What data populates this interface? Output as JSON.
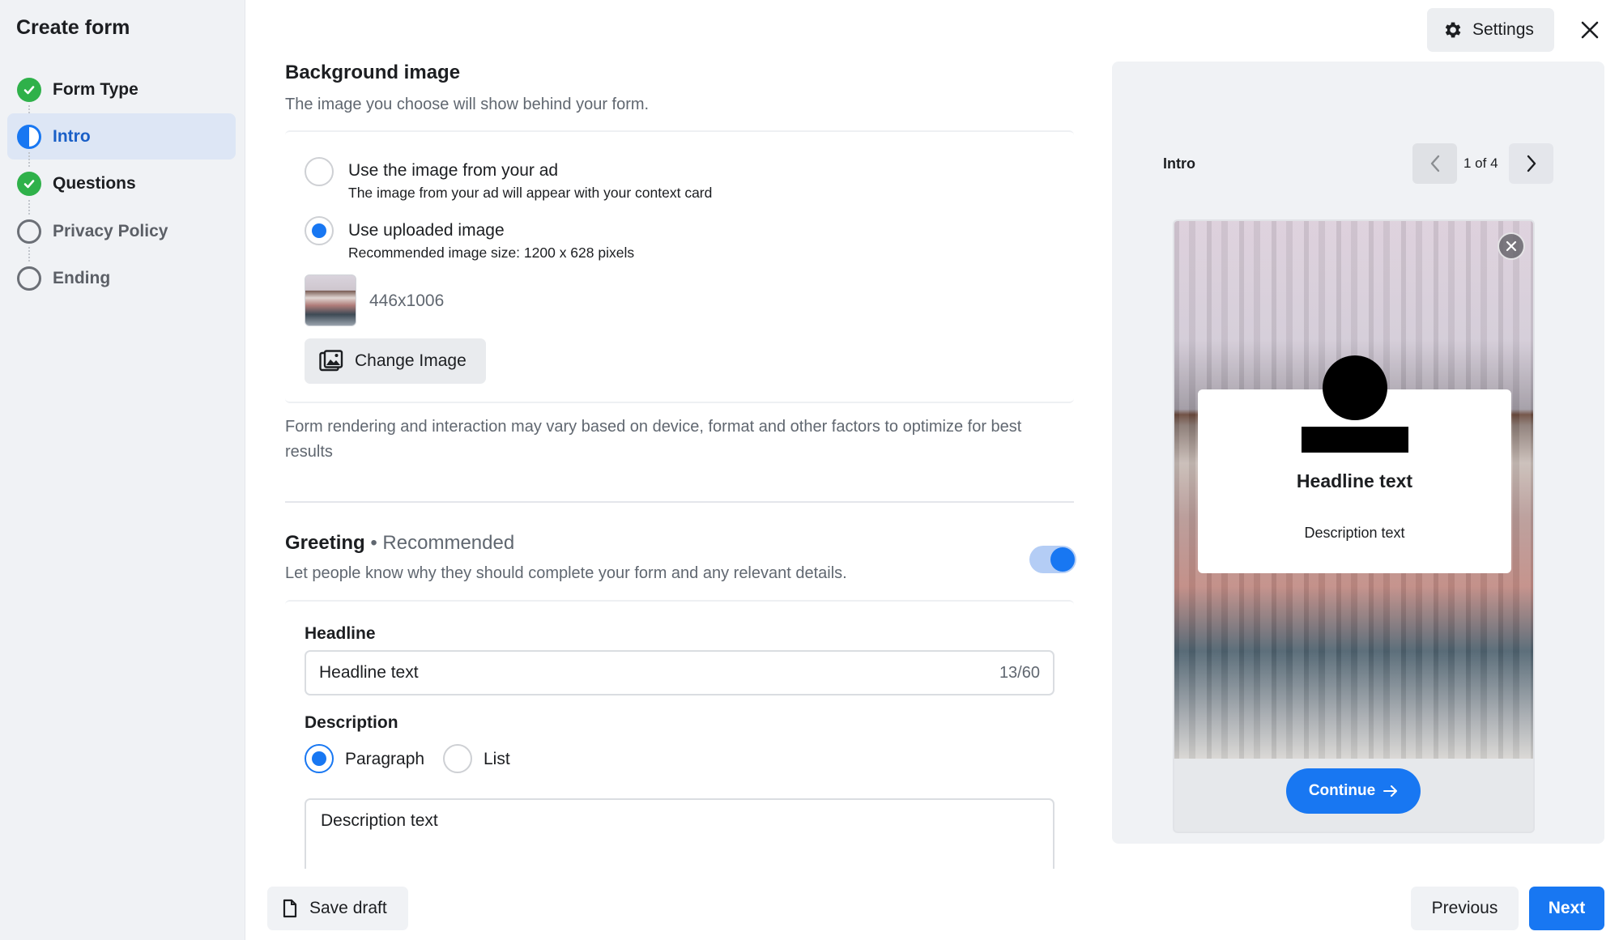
{
  "sidebar": {
    "title": "Create form",
    "steps": [
      {
        "label": "Form Type",
        "state": "complete"
      },
      {
        "label": "Intro",
        "state": "active"
      },
      {
        "label": "Questions",
        "state": "complete"
      },
      {
        "label": "Privacy Policy",
        "state": "incomplete"
      },
      {
        "label": "Ending",
        "state": "incomplete"
      }
    ]
  },
  "header": {
    "settings_label": "Settings",
    "close_icon": "close-icon",
    "settings_icon": "gear-icon"
  },
  "background_image": {
    "title": "Background image",
    "subtitle": "The image you choose will show behind your form.",
    "options": [
      {
        "label": "Use the image from your ad",
        "sublabel": "The image from your ad will appear with your context card",
        "selected": false
      },
      {
        "label": "Use uploaded image",
        "sublabel": "Recommended image size: 1200 x 628 pixels",
        "selected": true
      }
    ],
    "thumbnail_size": "446x1006",
    "change_button": "Change Image",
    "note": "Form rendering and interaction may vary based on device, format and other factors to optimize for best results"
  },
  "greeting": {
    "title": "Greeting",
    "badge": "• Recommended",
    "subtitle": "Let people know why they should complete your form and any relevant details.",
    "enabled": true,
    "headline_label": "Headline",
    "headline_value": "Headline text",
    "headline_counter": "13/60",
    "description_label": "Description",
    "description_formats": [
      {
        "label": "Paragraph",
        "selected": true
      },
      {
        "label": "List",
        "selected": false
      }
    ],
    "description_value": "Description text"
  },
  "footer": {
    "save_draft": "Save draft",
    "previous": "Previous",
    "next": "Next"
  },
  "preview": {
    "section": "Intro",
    "page_indicator": "1 of 4",
    "headline": "Headline text",
    "description": "Description text",
    "continue_label": "Continue"
  },
  "colors": {
    "accent": "#1877f2",
    "success": "#2fb14a",
    "active_step_bg": "#dde6f5"
  }
}
